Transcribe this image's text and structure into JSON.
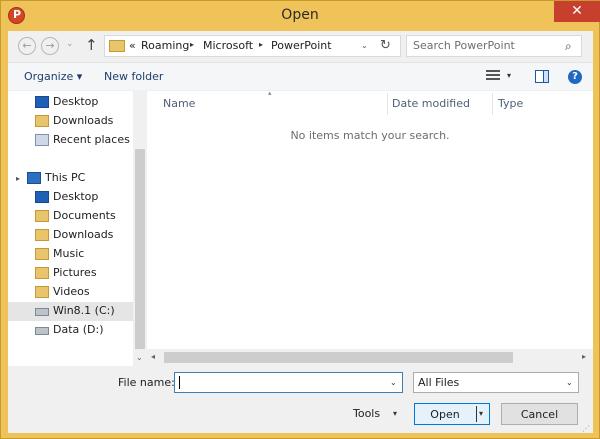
{
  "window": {
    "title": "Open",
    "close_glyph": "✕"
  },
  "nav": {
    "back_glyph": "←",
    "forward_glyph": "→",
    "recent_glyph": "⌄",
    "up_glyph": "↑",
    "address": {
      "overflow": "«",
      "segments": [
        "Roaming",
        "Microsoft",
        "PowerPoint"
      ],
      "separator": "▸",
      "dropdown_glyph": "⌄",
      "refresh_glyph": "↻"
    },
    "search": {
      "placeholder": "Search PowerPoint",
      "icon": "⌕"
    }
  },
  "toolbar": {
    "organize_label": "Organize ▾",
    "new_folder_label": "New folder",
    "views_dd_glyph": "▾",
    "help_glyph": "?"
  },
  "navpane": {
    "items": [
      {
        "label": "Desktop",
        "icon": "desktop-icon"
      },
      {
        "label": "Downloads",
        "icon": "folder-icon"
      },
      {
        "label": "Recent places",
        "icon": "recent-places-icon"
      },
      {
        "label": "This PC",
        "icon": "computer-icon"
      },
      {
        "label": "Desktop",
        "icon": "desktop-folder-icon"
      },
      {
        "label": "Documents",
        "icon": "folder-icon"
      },
      {
        "label": "Downloads",
        "icon": "folder-icon"
      },
      {
        "label": "Music",
        "icon": "music-icon"
      },
      {
        "label": "Pictures",
        "icon": "pictures-icon"
      },
      {
        "label": "Videos",
        "icon": "videos-icon"
      },
      {
        "label": "Win8.1 (C:)",
        "icon": "drive-icon"
      },
      {
        "label": "Data (D:)",
        "icon": "drive-icon"
      }
    ],
    "expander_glyph": "▸",
    "down_glyph": "⌄"
  },
  "filepane": {
    "columns": [
      "Name",
      "Date modified",
      "Type"
    ],
    "sort_glyph": "▴",
    "empty_message": "No items match your search."
  },
  "hscroll": {
    "left_glyph": "◂",
    "right_glyph": "▸"
  },
  "bottom": {
    "file_name_label": "File name:",
    "file_name_value": "",
    "file_type_value": "All Files",
    "dropdown_glyph": "⌄",
    "tools_label": "Tools",
    "tools_dd_glyph": "▾",
    "open_label": "Open",
    "open_dd_glyph": "▾",
    "cancel_label": "Cancel",
    "grip_glyph": "⋰"
  },
  "colors": {
    "title_bar": "#f0c25a",
    "close_button": "#c7402d",
    "accent": "#0078d7"
  }
}
